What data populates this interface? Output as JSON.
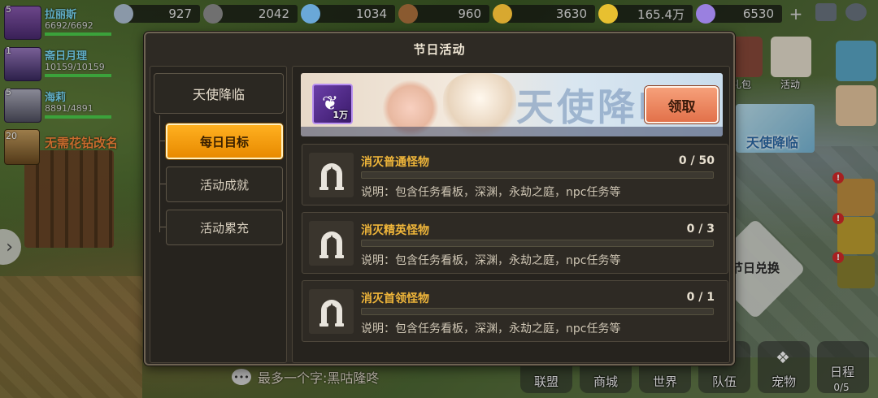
{
  "top_resources": [
    {
      "icon": "stone-icon",
      "value": "927"
    },
    {
      "icon": "iron-ore-icon",
      "value": "2042"
    },
    {
      "icon": "crystal-icon",
      "value": "1034"
    },
    {
      "icon": "wood-icon",
      "value": "960"
    },
    {
      "icon": "wheat-icon",
      "value": "3630"
    },
    {
      "icon": "gold-coin-icon",
      "value": "165.4万"
    },
    {
      "icon": "diamond-icon",
      "value": "6530"
    }
  ],
  "party": [
    {
      "level": "5",
      "name": "拉丽斯",
      "hp": "6692/6692",
      "hp_ratio": 1
    },
    {
      "level": "1",
      "name": "斋日月理",
      "hp": "10159/10159",
      "hp_ratio": 1
    },
    {
      "level": "5",
      "name": "海莉",
      "hp": "8891/4891",
      "hp_ratio": 1
    }
  ],
  "pet": {
    "level": "20",
    "name": "无需花钻改名"
  },
  "right_side": {
    "gift_label": "礼包",
    "activity_label": "活动",
    "banner_label": "天使降临",
    "exchange_label": "节日兑换"
  },
  "dialog": {
    "title": "节日活动",
    "main_tab": "天使降临",
    "sub_tabs": [
      {
        "label": "每日目标",
        "active": true
      },
      {
        "label": "活动成就",
        "active": false
      },
      {
        "label": "活动累充",
        "active": false
      }
    ],
    "banner": {
      "title_text": "天使降临",
      "reward_icon": "angel-wing-icon",
      "reward_qty": "1万",
      "claim_label": "领取"
    },
    "tasks": [
      {
        "icon": "horseshoe-star-icon",
        "name": "消灭普通怪物",
        "current": 0,
        "target": 50,
        "progress": "0 / 50",
        "desc": "说明：包含任务看板，深渊，永劫之庭，npc任务等"
      },
      {
        "icon": "horseshoe-star-icon",
        "name": "消灭精英怪物",
        "current": 0,
        "target": 3,
        "progress": "0 / 3",
        "desc": "说明：包含任务看板，深渊，永劫之庭，npc任务等"
      },
      {
        "icon": "horseshoe-star-icon",
        "name": "消灭首领怪物",
        "current": 0,
        "target": 1,
        "progress": "0 / 1",
        "desc": "说明：包含任务看板，深渊，永劫之庭，npc任务等"
      }
    ]
  },
  "chat": {
    "text": "最多一个字:黑咕隆咚"
  },
  "bottom_nav": [
    {
      "label": "联盟"
    },
    {
      "label": "商城"
    },
    {
      "label": "世界"
    },
    {
      "label": "队伍"
    },
    {
      "label": "宠物"
    },
    {
      "label": "日程",
      "sub": "0/5"
    }
  ],
  "colors": {
    "panel_bg": "#2e2a24",
    "task_title": "#f0b63a",
    "active_tab": "#ffa510",
    "claim_button": "#ec8a62"
  }
}
